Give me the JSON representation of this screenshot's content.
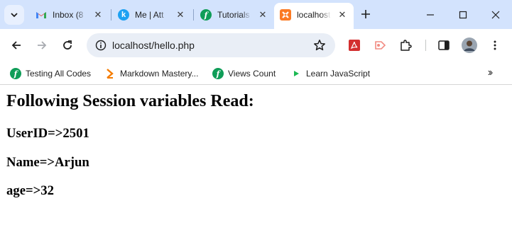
{
  "tabs": [
    {
      "title": "Inbox (8",
      "favicon": "gmail-icon"
    },
    {
      "title": "Me | Att",
      "favicon": "k-icon"
    },
    {
      "title": "Tutorials",
      "favicon": "tutorials-icon"
    },
    {
      "title": "localhost",
      "favicon": "xampp-icon",
      "active": true
    }
  ],
  "toolbar": {
    "url": "localhost/hello.php"
  },
  "bookmarks": [
    {
      "label": "Testing All Codes",
      "favicon": "tutorials-icon"
    },
    {
      "label": "Markdown Mastery...",
      "favicon": "chevron-bookmark-icon"
    },
    {
      "label": "Views Count",
      "favicon": "tutorials-icon"
    },
    {
      "label": "Learn JavaScript",
      "favicon": "play-icon"
    }
  ],
  "page": {
    "heading": "Following Session variables Read:",
    "lines": [
      "UserID=>2501",
      "Name=>Arjun",
      "age=>32"
    ]
  },
  "colors": {
    "tabstrip": "#d3e3fd",
    "omnibox": "#e9eef6",
    "tutorials_green": "#0f9d58",
    "xampp_orange": "#fb7a24",
    "k_blue": "#1da1f2"
  }
}
